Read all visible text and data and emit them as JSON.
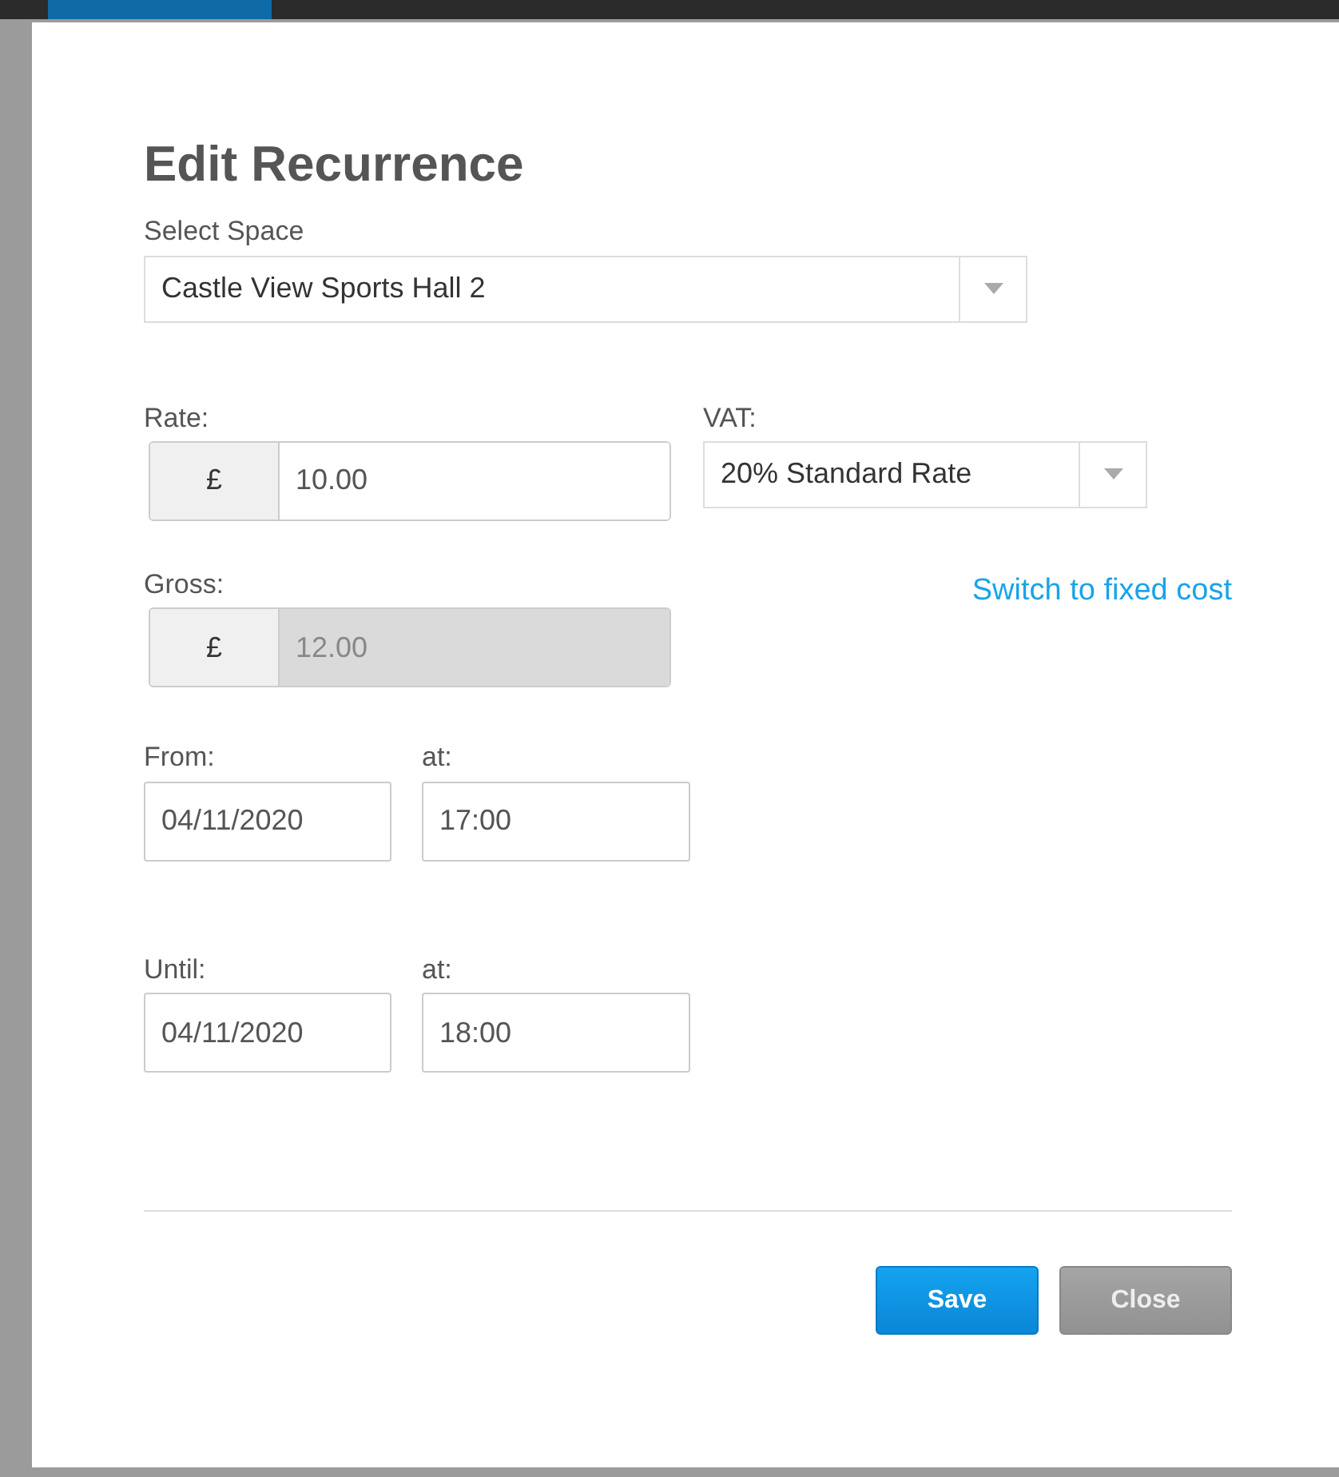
{
  "dialog": {
    "title": "Edit Recurrence",
    "space": {
      "label": "Select Space",
      "value": "Castle View Sports Hall 2"
    },
    "rate": {
      "label": "Rate:",
      "currency": "£",
      "value": "10.00"
    },
    "vat": {
      "label": "VAT:",
      "value": "20% Standard Rate"
    },
    "gross": {
      "label": "Gross:",
      "currency": "£",
      "value": "12.00",
      "disabled": true
    },
    "switch_link": "Switch to fixed cost",
    "from": {
      "label": "From:",
      "date": "04/11/2020",
      "at_label": "at:",
      "time": "17:00"
    },
    "until": {
      "label": "Until:",
      "date": "04/11/2020",
      "at_label": "at:",
      "time": "18:00"
    },
    "buttons": [
      {
        "label": "Save",
        "kind": "primary"
      },
      {
        "label": "Close",
        "kind": "secondary"
      }
    ]
  }
}
